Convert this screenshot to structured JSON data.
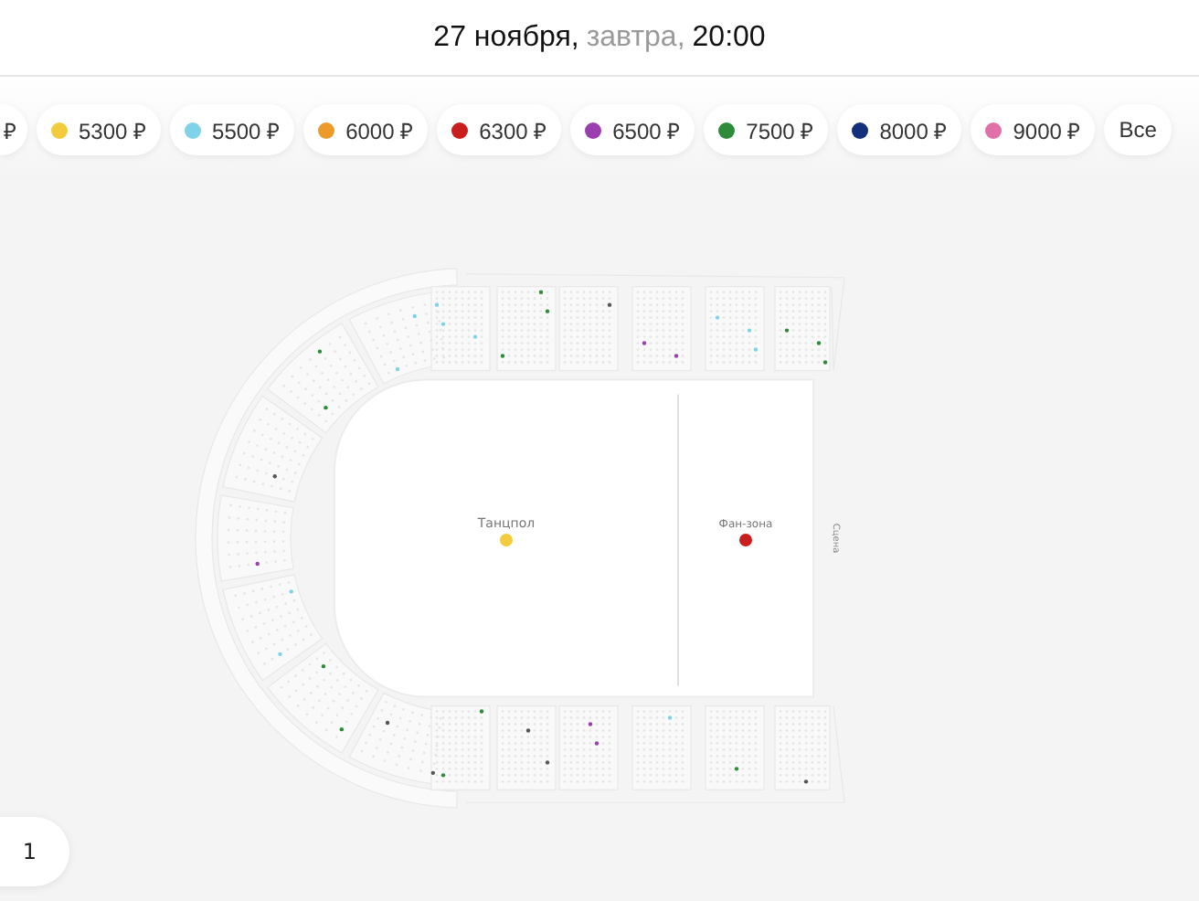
{
  "header": {
    "date": "27 ноября,",
    "relative_day": "завтра,",
    "time": "20:00"
  },
  "price_filters": [
    {
      "label": "₽"
    },
    {
      "label": "5300 ₽",
      "color": "#f2cc3d"
    },
    {
      "label": "5500 ₽",
      "color": "#7fd3e8"
    },
    {
      "label": "6000 ₽",
      "color": "#ec9a2a"
    },
    {
      "label": "6300 ₽",
      "color": "#c81e1e"
    },
    {
      "label": "6500 ₽",
      "color": "#9b3fb0"
    },
    {
      "label": "7500 ₽",
      "color": "#2e8b3a"
    },
    {
      "label": "8000 ₽",
      "color": "#13307a"
    },
    {
      "label": "9000 ₽",
      "color": "#e070a8"
    },
    {
      "label": "Все"
    }
  ],
  "hall_map": {
    "zones": [
      {
        "label": "Танцпол",
        "color": "#f2cc3d"
      },
      {
        "label": "Фан-зона",
        "color": "#c81e1e"
      }
    ],
    "stage": "Сцена"
  },
  "zoom_control": {
    "value": "1"
  }
}
